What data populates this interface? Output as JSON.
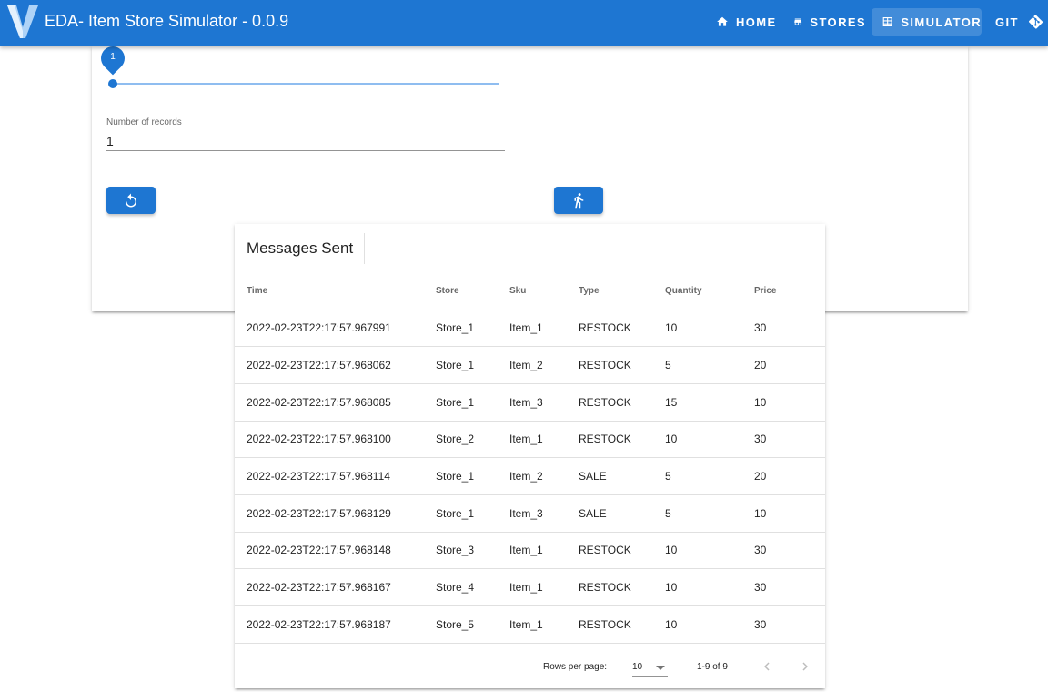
{
  "app": {
    "title": "EDA- Item Store Simulator - 0.0.9"
  },
  "nav": {
    "home": "HOME",
    "stores": "STORES",
    "simulator": "SIMULATOR",
    "git": "GIT"
  },
  "simulator": {
    "slider_value": "1",
    "records_label": "Number of records",
    "records_value": "1"
  },
  "messages": {
    "title": "Messages Sent",
    "columns": [
      "Time",
      "Store",
      "Sku",
      "Type",
      "Quantity",
      "Price"
    ],
    "rows": [
      [
        "2022-02-23T22:17:57.967991",
        "Store_1",
        "Item_1",
        "RESTOCK",
        "10",
        "30"
      ],
      [
        "2022-02-23T22:17:57.968062",
        "Store_1",
        "Item_2",
        "RESTOCK",
        "5",
        "20"
      ],
      [
        "2022-02-23T22:17:57.968085",
        "Store_1",
        "Item_3",
        "RESTOCK",
        "15",
        "10"
      ],
      [
        "2022-02-23T22:17:57.968100",
        "Store_2",
        "Item_1",
        "RESTOCK",
        "10",
        "30"
      ],
      [
        "2022-02-23T22:17:57.968114",
        "Store_1",
        "Item_2",
        "SALE",
        "5",
        "20"
      ],
      [
        "2022-02-23T22:17:57.968129",
        "Store_1",
        "Item_3",
        "SALE",
        "5",
        "10"
      ],
      [
        "2022-02-23T22:17:57.968148",
        "Store_3",
        "Item_1",
        "RESTOCK",
        "10",
        "30"
      ],
      [
        "2022-02-23T22:17:57.968167",
        "Store_4",
        "Item_1",
        "RESTOCK",
        "10",
        "30"
      ],
      [
        "2022-02-23T22:17:57.968187",
        "Store_5",
        "Item_1",
        "RESTOCK",
        "10",
        "30"
      ]
    ],
    "footer": {
      "rows_per_page_label": "Rows per page:",
      "rows_per_page_value": "10",
      "range": "1-9 of 9"
    }
  },
  "colors": {
    "primary": "#1e76d2",
    "slider_track": "#8fbdf0"
  },
  "icons": {
    "home": "home-icon",
    "stores": "store-icon",
    "simulator": "table-icon",
    "git": "git-icon",
    "reset": "refresh-icon",
    "run": "run-icon"
  }
}
